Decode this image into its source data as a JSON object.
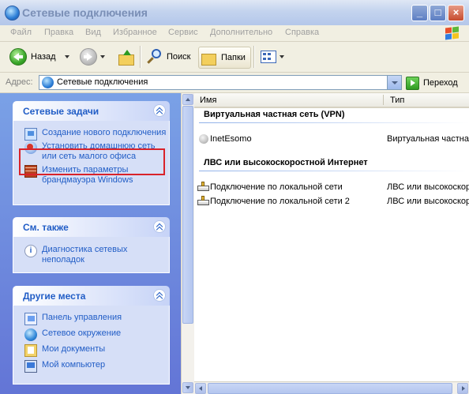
{
  "window": {
    "title": "Сетевые подключения"
  },
  "menu": [
    "Файл",
    "Правка",
    "Вид",
    "Избранное",
    "Сервис",
    "Дополнительно",
    "Справка"
  ],
  "toolbar": {
    "back_label": "Назад",
    "search_label": "Поиск",
    "folders_label": "Папки"
  },
  "address": {
    "label": "Адрес:",
    "value": "Сетевые подключения",
    "go_label": "Переход"
  },
  "tasks": {
    "network": {
      "title": "Сетевые задачи",
      "items": [
        "Создание нового подключения",
        "Установить домашнюю сеть или сеть малого офиса",
        "Изменить параметры брандмауэра Windows"
      ]
    },
    "see_also": {
      "title": "См. также",
      "items": [
        "Диагностика сетевых неполадок"
      ]
    },
    "other_places": {
      "title": "Другие места",
      "items": [
        "Панель управления",
        "Сетевое окружение",
        "Мои документы",
        "Мой компьютер"
      ]
    }
  },
  "columns": {
    "name": "Имя",
    "type": "Тип"
  },
  "groups": [
    {
      "title": "Виртуальная частная сеть (VPN)",
      "items": [
        {
          "name": "InetEsomo",
          "type": "Виртуальная частная сеть"
        }
      ]
    },
    {
      "title": "ЛВС или высокоскоростной Интернет",
      "items": [
        {
          "name": "Подключение по локальной сети",
          "type": "ЛВС или высокоскоростной Интернет"
        },
        {
          "name": "Подключение по локальной сети 2",
          "type": "ЛВС или высокоскоростной Интернет"
        }
      ]
    }
  ],
  "colors": {
    "task_link": "#215dc6",
    "taskpane_top": "#7aa1e6",
    "taskpane_bottom": "#6375d6",
    "highlight_box": "#d9222a"
  }
}
